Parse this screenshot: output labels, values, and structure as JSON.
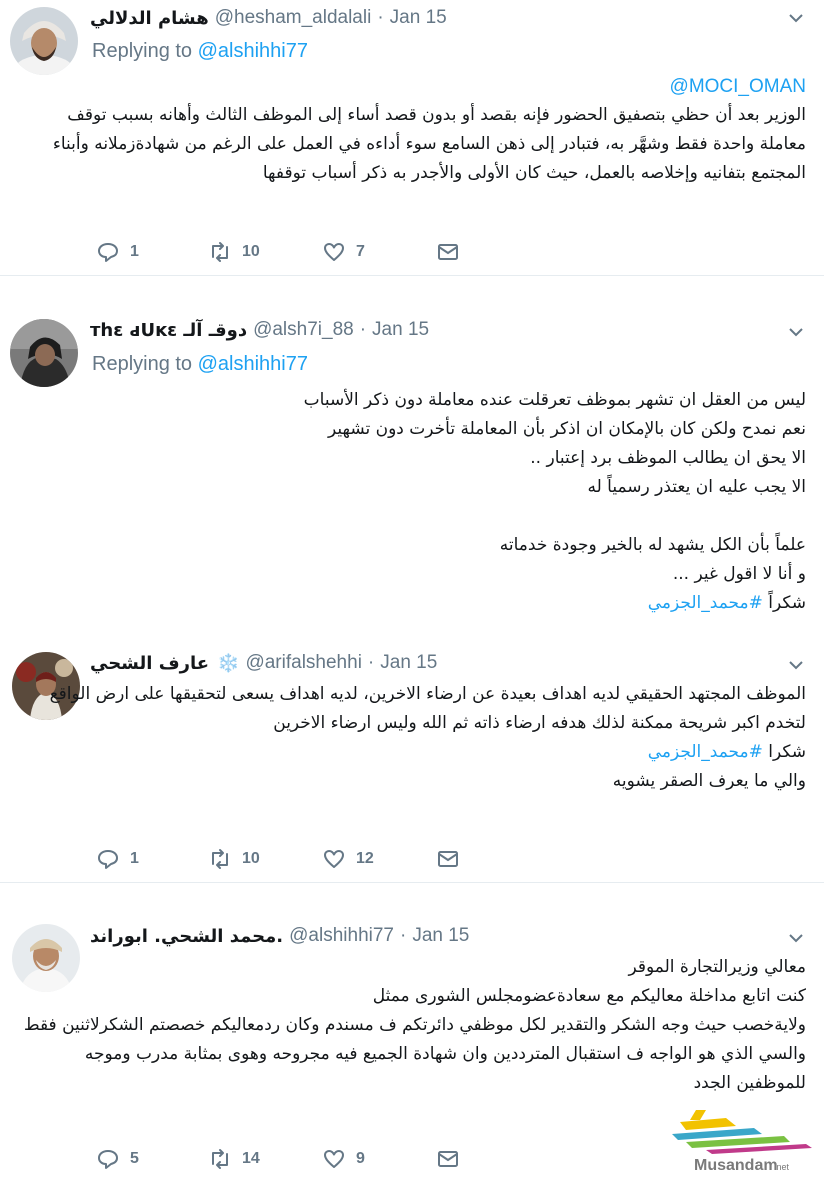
{
  "tweets": [
    {
      "display_name": "هشام الدلالي",
      "handle": "@hesham_aldalali",
      "dot": "·",
      "date": "Jan 15",
      "replying_prefix": "Replying to",
      "replying_to": "@alshihhi77",
      "mention": "@MOCI_OMAN",
      "lines": [
        "الوزير بعد أن حظي بتصفيق الحضور فإنه بقصد أو بدون قصد أساء إلى الموظف الثالث وأهانه بسبب توقف",
        "معاملة واحدة فقط وشهَّر به، فتبادر إلى ذهن السامع سوء أداءه في العمل على الرغم من شهادةزملانه وأبناء",
        "المجتمع بتفانيه وإخلاصه بالعمل، حيث كان الأولى والأجدر به ذكر أسباب توقفها"
      ],
      "replies": "1",
      "retweets": "10",
      "likes": "7"
    },
    {
      "display_name": "ᴛһε ԁUĸε دوقـ آلـ",
      "handle": "@alsh7i_88",
      "dot": "·",
      "date": "Jan 15",
      "replying_prefix": "Replying to",
      "replying_to": "@alshihhi77",
      "lines": [
        "ليس من العقل ان تشهر بموظف تعرقلت عنده معاملة دون ذكر الأسباب",
        "نعم نمدح ولكن كان بالإمكان ان اذكر بأن المعاملة تأخرت دون تشهير",
        "الا يحق ان يطالب الموظف برد إعتبار ..",
        "الا يجب عليه ان يعتذر رسمياً له",
        "",
        "علماً بأن الكل يشهد له بالخير وجودة خدماته",
        "و أنا لا اقول غير ..."
      ],
      "last_prefix": "شكراً ",
      "hashtag": "#محمد_الجزمي"
    },
    {
      "display_name": "عارف الشحي",
      "snowflake": "❄️",
      "handle": "@arifalshehhi",
      "dot": "·",
      "date": "Jan 15",
      "lines": [
        "الموظف المجتهد الحقيقي لديه اهداف بعيدة عن ارضاء الاخرين، لديه اهداف يسعى لتحقيقها على ارض الواقع",
        "لتخدم اكبر شريحة ممكنة لذلك هدفه ارضاء ذاته ثم الله وليس ارضاء الاخرين"
      ],
      "thanks_prefix": "شكرا ",
      "hashtag": "#محمد_الجزمي",
      "last_line": "والي ما يعرف الصقر يشويه",
      "replies": "1",
      "retweets": "10",
      "likes": "12"
    },
    {
      "display_name": "محمد الشحي. ابوراند.",
      "handle": "@alshihhi77",
      "dot": "·",
      "date": "Jan 15",
      "lines": [
        "معالي وزيرالتجارة الموقر",
        "كنت اتابع مداخلة معاليكم مع سعادةعضومجلس الشورى ممثل",
        "ولايةخصب حيث وجه الشكر والتقدير لكل موظفي دائرتكم ف  مسندم وكان ردمعاليكم خصصتم الشكرلاثنين فقط",
        "والسي الذي هو الواجه ف استقبال المترددين وان شهادة الجميع فيه مجروحه وهوى بمثابة مدرب وموجه",
        "للموظفين الجدد"
      ],
      "replies": "5",
      "retweets": "14",
      "likes": "9"
    }
  ],
  "watermark": {
    "label": "Musandam",
    "suffix": ".net"
  },
  "colors": {
    "link": "#1da1f2",
    "muted": "#657786",
    "divider": "#e6ecf0"
  }
}
